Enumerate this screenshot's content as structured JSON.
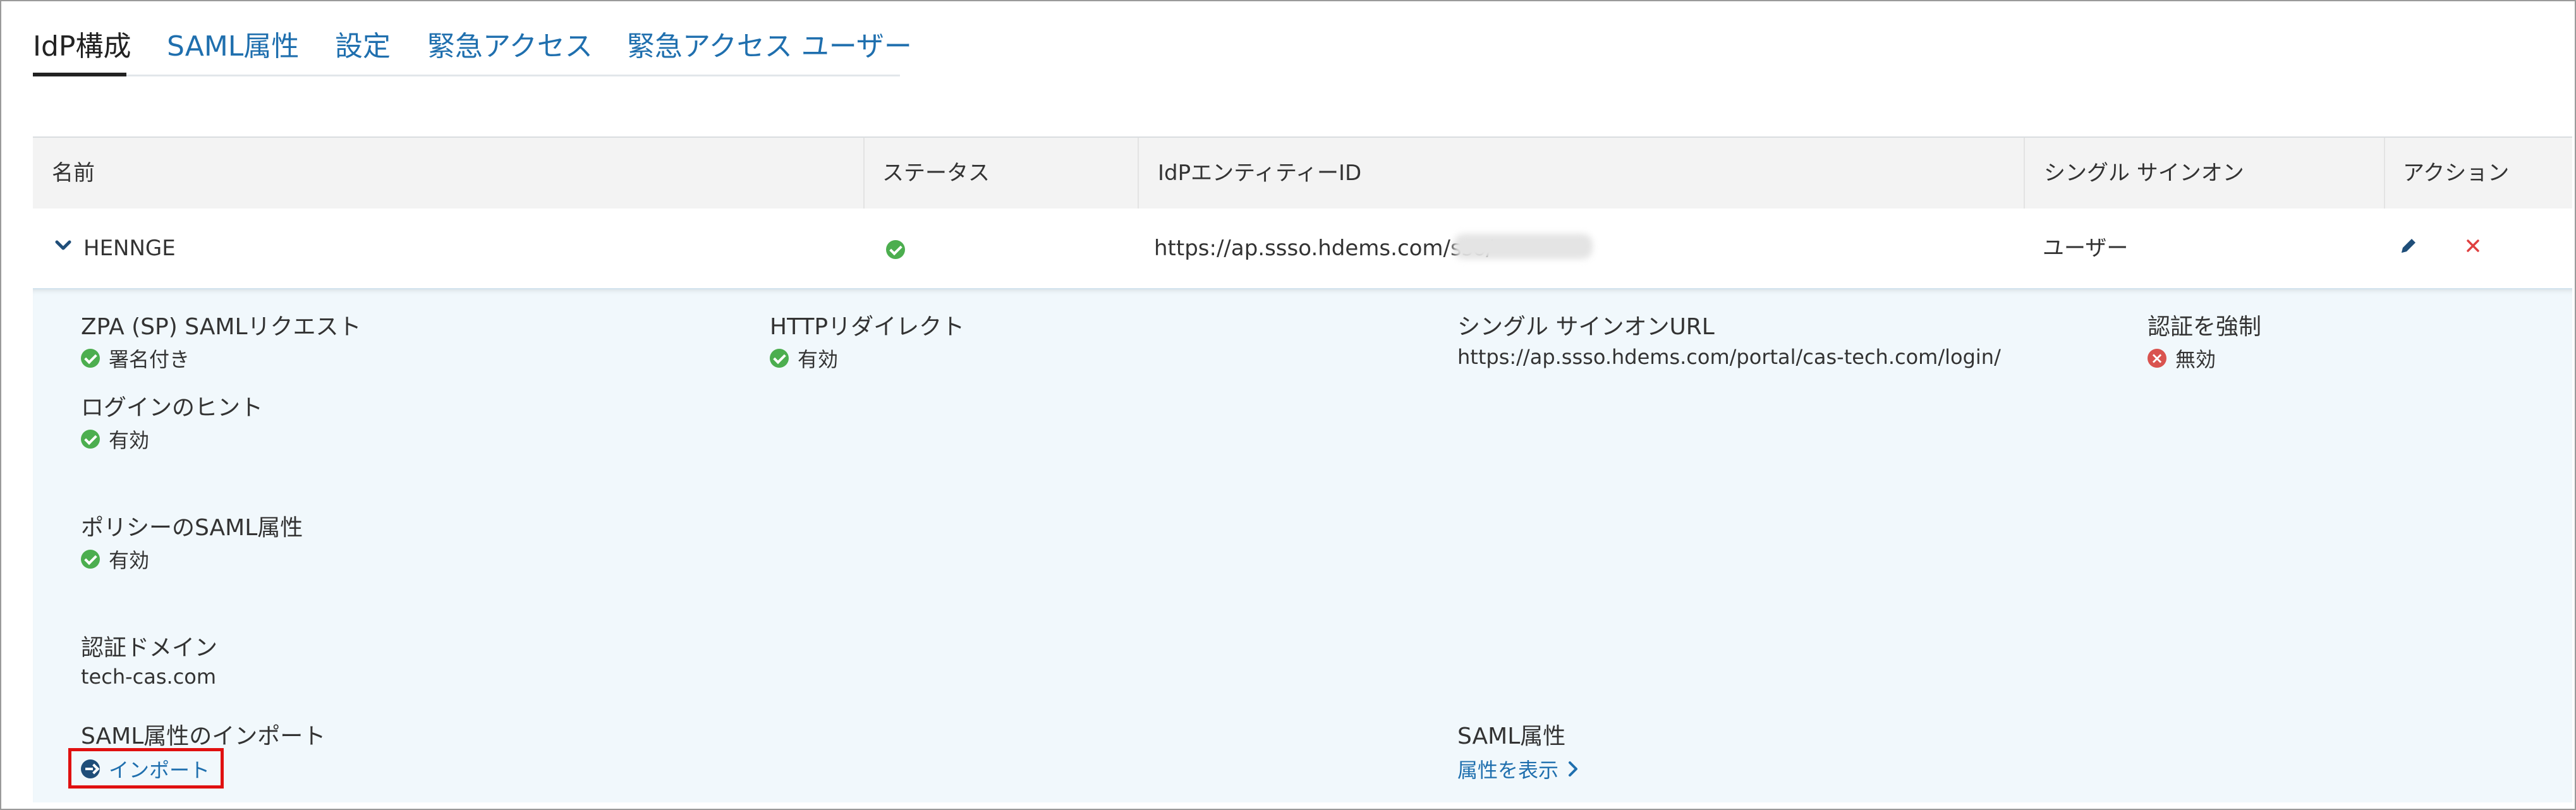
{
  "tabs": [
    {
      "label": "IdP構成",
      "active": true
    },
    {
      "label": "SAML属性"
    },
    {
      "label": "設定"
    },
    {
      "label": "緊急アクセス"
    },
    {
      "label": "緊急アクセス ユーザー"
    }
  ],
  "table": {
    "headers": {
      "name": "名前",
      "status": "ステータス",
      "entity_id": "IdPエンティティーID",
      "sso": "シングル サインオン",
      "actions": "アクション"
    },
    "row": {
      "name": "HENNGE",
      "status_icon": "check-circle-icon",
      "entity_id": "https://ap.ssso.hdems.com/sso/",
      "sso": "ユーザー"
    }
  },
  "detail": {
    "zpa_sp_request": {
      "label": "ZPA (SP) SAMLリクエスト",
      "value": "署名付き"
    },
    "http_redirect": {
      "label": "HTTPリダイレクト",
      "value": "有効"
    },
    "sso_url": {
      "label": "シングル サインオンURL",
      "value": "https://ap.ssso.hdems.com/portal/cas-tech.com/login/"
    },
    "force_auth": {
      "label": "認証を強制",
      "value": "無効"
    },
    "login_hint": {
      "label": "ログインのヒント",
      "value": "有効"
    },
    "policy_saml": {
      "label": "ポリシーのSAML属性",
      "value": "有効"
    },
    "auth_domain": {
      "label": "認証ドメイン",
      "value": "tech-cas.com"
    },
    "saml_import": {
      "label": "SAML属性のインポート",
      "link": "インポート"
    },
    "saml_attr": {
      "label": "SAML属性",
      "link": "属性を表示"
    }
  },
  "colors": {
    "link": "#1f6fae",
    "success": "#4cae4f",
    "danger": "#d9534f",
    "highlight_box": "#e01010",
    "detail_bg": "#f1f8fc"
  }
}
